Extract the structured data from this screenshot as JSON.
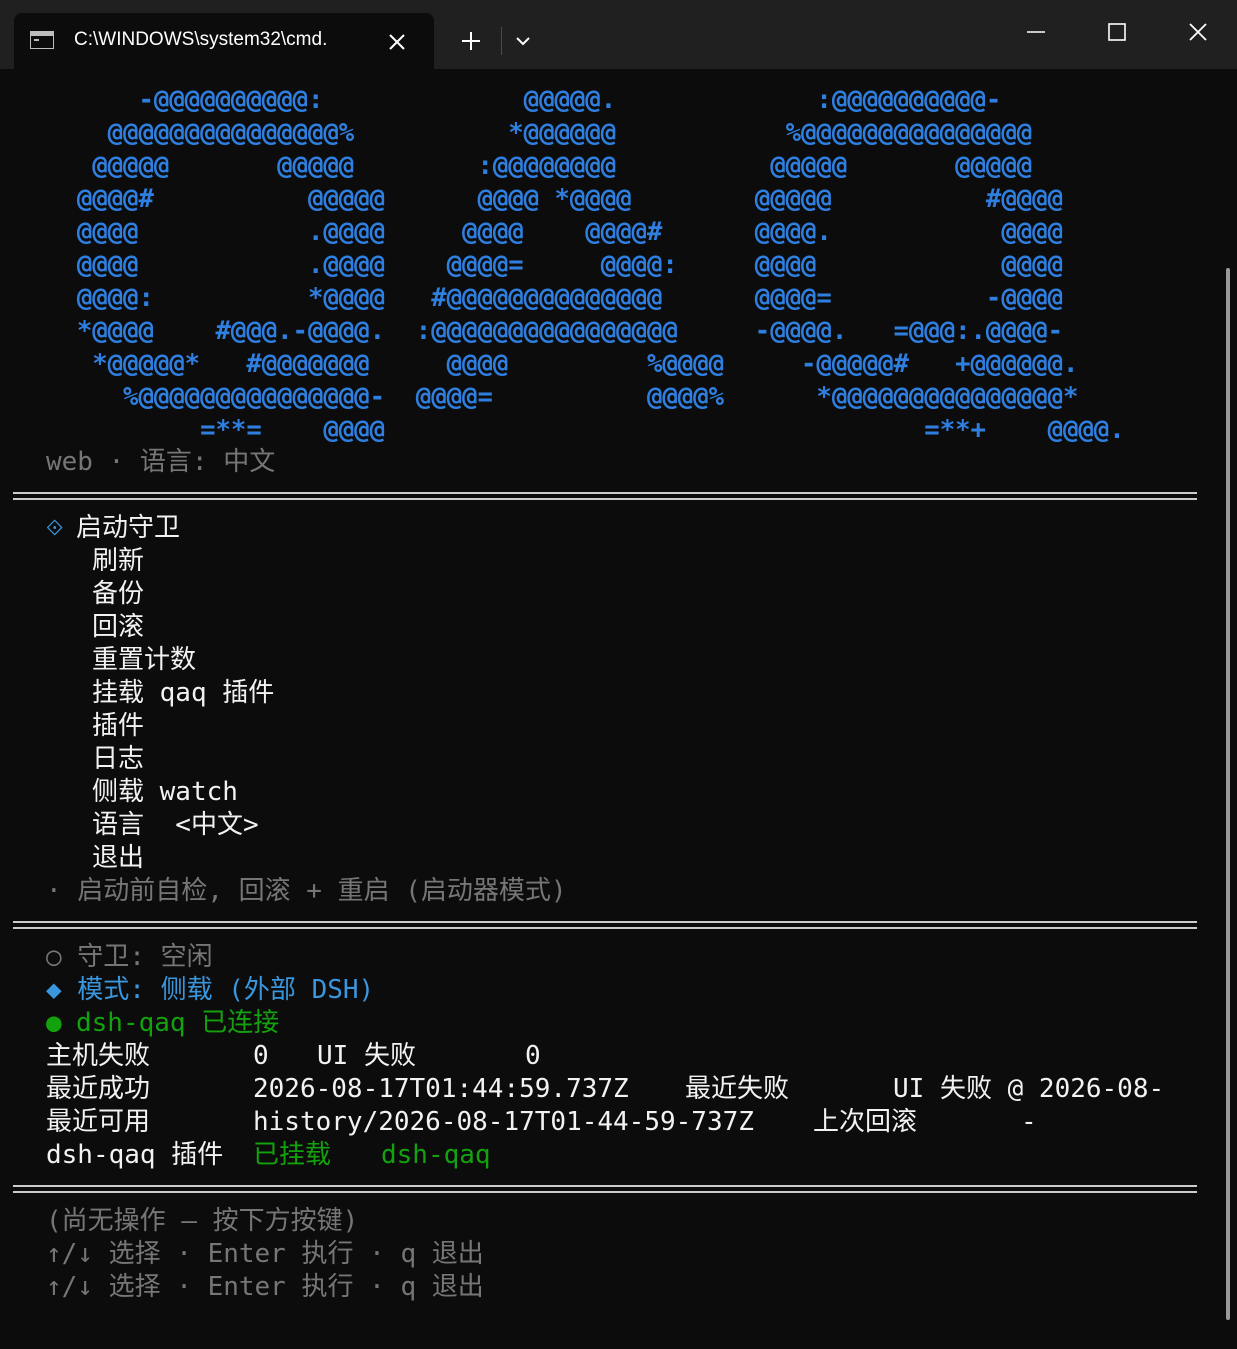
{
  "window": {
    "tab_title": "C:\\WINDOWS\\system32\\cmd.",
    "new_tab_glyph": "+"
  },
  "logo": {
    "art": "      -@@@@@@@@@@:             @@@@@.             :@@@@@@@@@@-\n    @@@@@@@@@@@@@@@%          *@@@@@@           %@@@@@@@@@@@@@@@\n   @@@@@       @@@@@        :@@@@@@@@          @@@@@       @@@@@\n  @@@@#          @@@@@      @@@@ *@@@@        @@@@@          #@@@@\n  @@@@           .@@@@     @@@@    @@@@#      @@@@.           @@@@\n  @@@@           .@@@@    @@@@=     @@@@:     @@@@            @@@@\n  @@@@:          *@@@@   #@@@@@@@@@@@@@@      @@@@=          -@@@@\n  *@@@@    #@@@.-@@@@.  :@@@@@@@@@@@@@@@@     -@@@@.   =@@@:.@@@@-\n   *@@@@@*   #@@@@@@@     @@@@         %@@@@     -@@@@@#   +@@@@@@.\n     %@@@@@@@@@@@@@@@-  @@@@=          @@@@%      *@@@@@@@@@@@@@@@*\n          =**=    @@@@                                   =**+    @@@@.",
    "color": "#2f7fe0"
  },
  "header": {
    "subtitle": "web · 语言: 中文"
  },
  "menu": {
    "marker": "⟐",
    "items": [
      {
        "label": "启动守卫"
      },
      {
        "label": "刷新"
      },
      {
        "label": "备份"
      },
      {
        "label": "回滚"
      },
      {
        "label": "重置计数"
      },
      {
        "label": "挂载 qaq 插件"
      },
      {
        "label": "插件"
      },
      {
        "label": "日志"
      },
      {
        "label": "侧载 watch"
      },
      {
        "label": "语言  <中文>"
      },
      {
        "label": "退出"
      }
    ],
    "hint": "· 启动前自检, 回滚 + 重启 (启动器模式)"
  },
  "status": {
    "guard": "○ 守卫: 空闲",
    "mode": "◆ 模式: 侧载 (外部 DSH)",
    "conn_dot": "●",
    "conn_text": "dsh-qaq 已连接",
    "rows": {
      "host_fail_label": "主机失败",
      "host_fail_value": "0",
      "ui_fail_label": "UI 失败",
      "ui_fail_value": "0",
      "last_success_label": "最近成功",
      "last_success_value": "2026-08-17T01:44:59.737Z",
      "last_fail_label": "最近失败",
      "last_fail_value": "UI 失败 @ 2026-08-",
      "last_ok_label": "最近可用",
      "last_ok_value": "history/2026-08-17T01-44-59-737Z",
      "last_rollback_label": "上次回滚",
      "last_rollback_value": "-",
      "plugin_label": "dsh-qaq 插件",
      "plugin_state": "已挂载",
      "plugin_name": "dsh-qaq"
    }
  },
  "footer": {
    "message": "(尚无操作 — 按下方按键)",
    "keys_line_1": "↑/↓ 选择 · Enter 执行 · q 退出",
    "keys_line_2": "↑/↓ 选择 · Enter 执行 · q 退出"
  },
  "colors": {
    "background": "#0c0c0c",
    "titlebar": "#202020",
    "blue": "#3a96dd",
    "green": "#13a10e",
    "dim": "#767676"
  }
}
